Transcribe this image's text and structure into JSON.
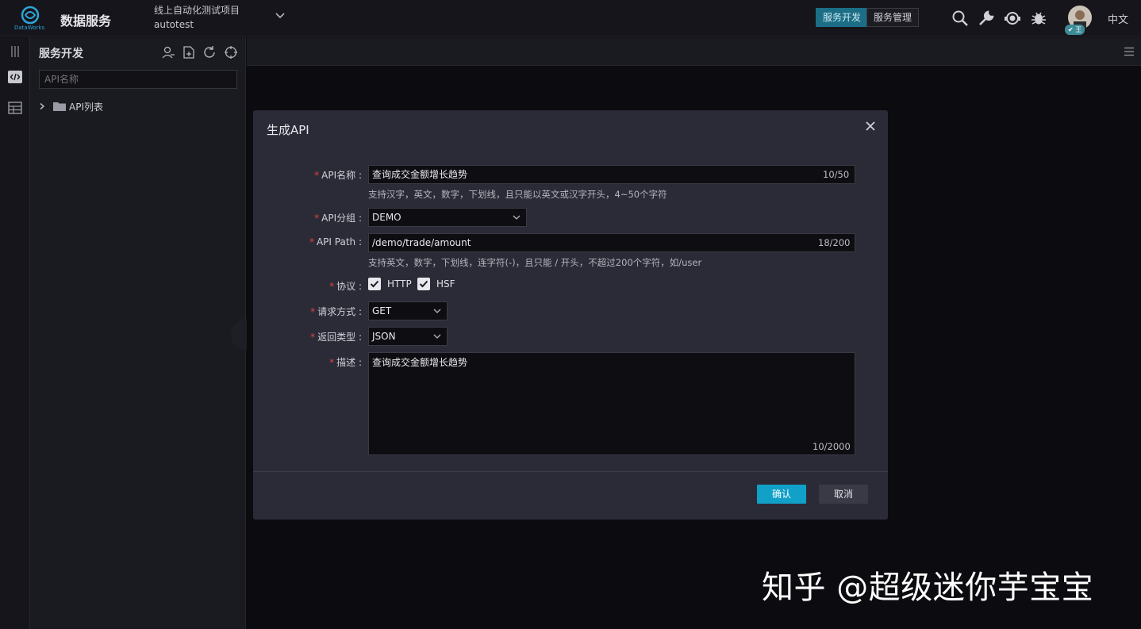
{
  "header": {
    "logo_text": "DataWorks",
    "app_title": "数据服务",
    "project_name": "线上自动化测试项目",
    "project_id": "autotest",
    "tabs": [
      "服务开发",
      "服务管理"
    ],
    "active_tab": "服务开发",
    "user_badge": "王",
    "language": "中文"
  },
  "sidebar": {
    "title": "服务开发",
    "search_placeholder": "API名称",
    "tree": [
      {
        "label": "API列表",
        "icon": "folder-icon"
      }
    ]
  },
  "modal": {
    "title": "生成API",
    "fields": {
      "api_name": {
        "label": "API名称 :",
        "value": "查询成交金额增长趋势",
        "counter": "10/50",
        "hint": "支持汉字，英文，数字，下划线，且只能以英文或汉字开头，4~50个字符"
      },
      "api_group": {
        "label": "API分组 :",
        "value": "DEMO"
      },
      "api_path": {
        "label": "API Path :",
        "value": "/demo/trade/amount",
        "counter": "18/200",
        "hint": "支持英文，数字，下划线，连字符(-)，且只能 / 开头，不超过200个字符，如/user"
      },
      "protocol": {
        "label": "协议 :",
        "options": [
          {
            "label": "HTTP",
            "checked": true
          },
          {
            "label": "HSF",
            "checked": true
          }
        ]
      },
      "request_method": {
        "label": "请求方式 :",
        "value": "GET"
      },
      "return_type": {
        "label": "返回类型 :",
        "value": "JSON"
      },
      "description": {
        "label": "描述 :",
        "value": "查询成交金额增长趋势",
        "counter": "10/2000"
      }
    },
    "confirm_label": "确认",
    "cancel_label": "取消"
  },
  "watermark": "知乎 @超级迷你芋宝宝",
  "colors": {
    "accent": "#10a0c8",
    "required": "#e0433a",
    "modal_bg": "#2b2b38"
  }
}
